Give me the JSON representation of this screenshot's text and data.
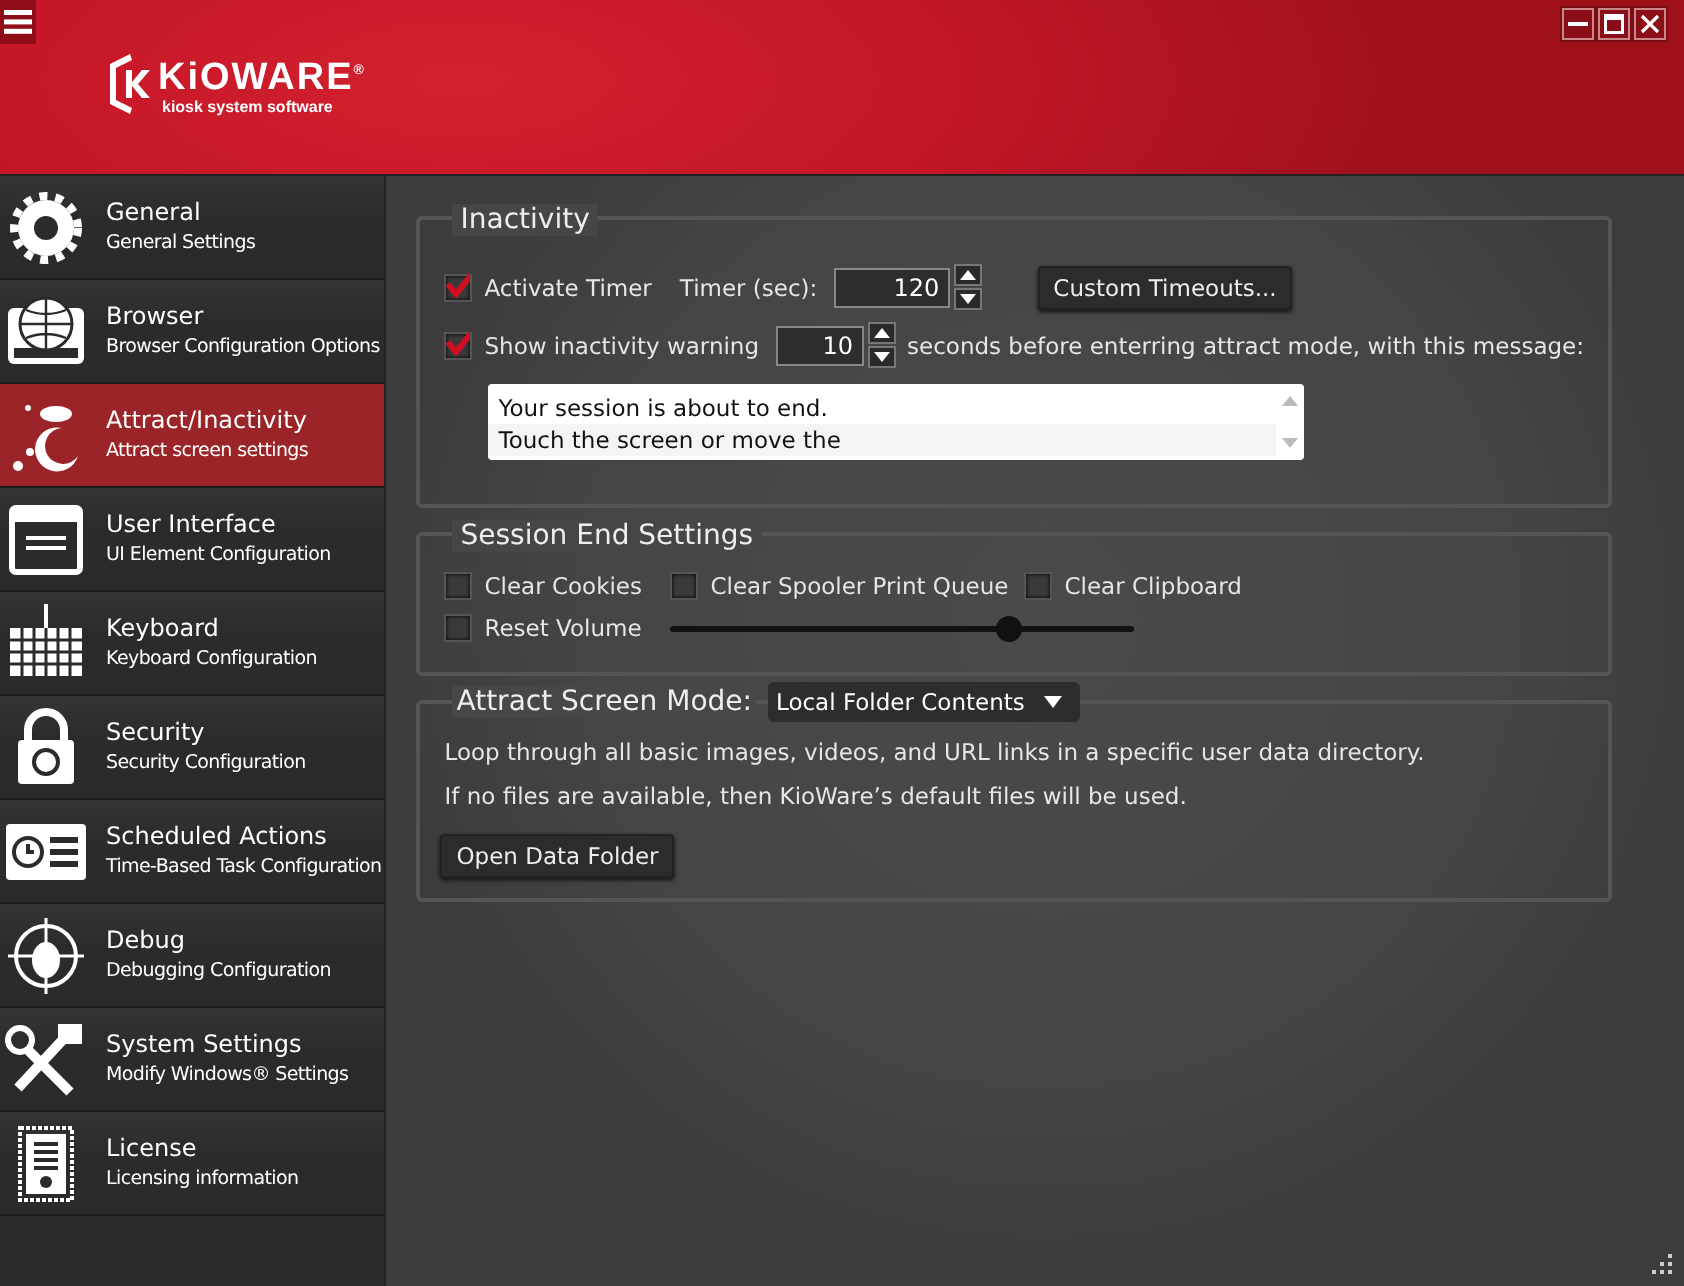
{
  "header": {
    "brand": "KiOWARE",
    "brand_mark": "®",
    "tagline": "kiosk system software"
  },
  "sidebar": {
    "items": [
      {
        "title": "General",
        "subtitle": "General Settings",
        "selected": false
      },
      {
        "title": "Browser",
        "subtitle": "Browser Configuration Options",
        "selected": false
      },
      {
        "title": "Attract/Inactivity",
        "subtitle": "Attract screen settings",
        "selected": true
      },
      {
        "title": "User Interface",
        "subtitle": "UI Element Configuration",
        "selected": false
      },
      {
        "title": "Keyboard",
        "subtitle": "Keyboard Configuration",
        "selected": false
      },
      {
        "title": "Security",
        "subtitle": "Security Configuration",
        "selected": false
      },
      {
        "title": "Scheduled Actions",
        "subtitle": "Time-Based Task Configuration",
        "selected": false
      },
      {
        "title": "Debug",
        "subtitle": "Debugging Configuration",
        "selected": false
      },
      {
        "title": "System Settings",
        "subtitle": "Modify Windows® Settings",
        "selected": false
      },
      {
        "title": "License",
        "subtitle": "Licensing information",
        "selected": false
      }
    ]
  },
  "inactivity": {
    "title": "Inactivity",
    "activate_timer": {
      "label": "Activate Timer",
      "checked": true
    },
    "timer_label": "Timer (sec):",
    "timer_value": "120",
    "custom_button": "Custom Timeouts...",
    "show_warning": {
      "label": "Show inactivity warning",
      "checked": true
    },
    "warning_value": "10",
    "warning_suffix": "seconds before enterring attract mode, with this message:",
    "message_lines": [
      "Your session is about to end.",
      "Touch the screen or move the"
    ]
  },
  "session_end": {
    "title": "Session End Settings",
    "options": [
      {
        "label": "Clear Cookies",
        "checked": false
      },
      {
        "label": "Clear Spooler Print Queue",
        "checked": false
      },
      {
        "label": "Clear Clipboard",
        "checked": false
      },
      {
        "label": "Reset Volume",
        "checked": false
      }
    ],
    "volume": {
      "level": 0.73
    }
  },
  "attract": {
    "title": "Attract Screen Mode:",
    "mode": "Local Folder Contents",
    "description": [
      "Loop through all basic images, videos, and URL links in a specific user data directory.",
      "If no files are available, then KioWare’s default files will be used."
    ],
    "button": "Open Data Folder"
  }
}
